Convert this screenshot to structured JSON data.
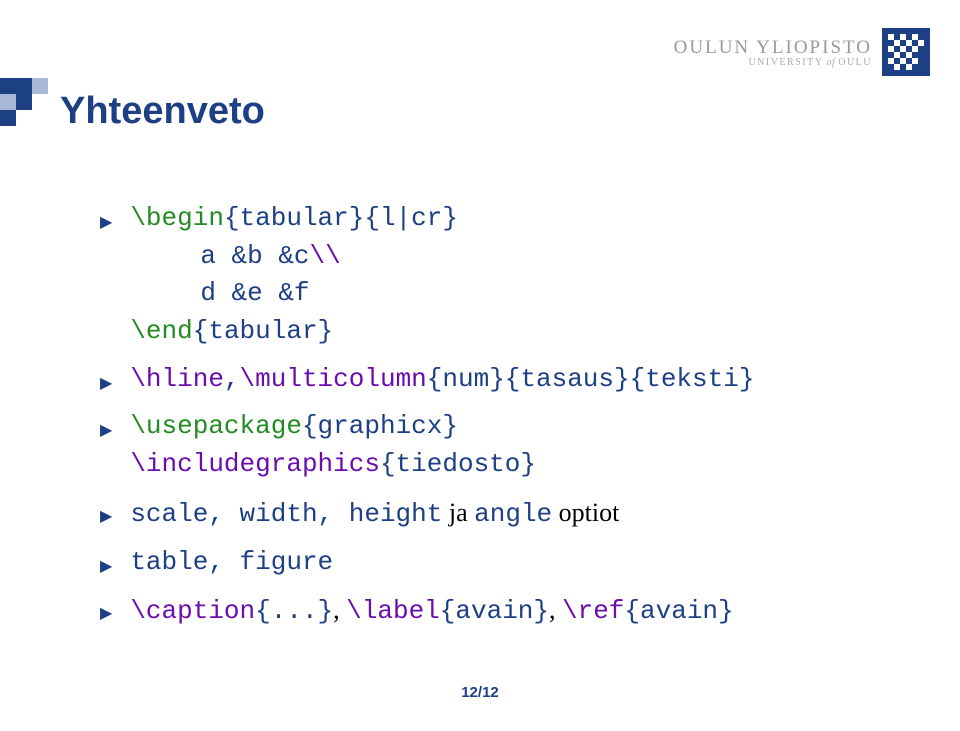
{
  "header": {
    "logo_main": "OULUN YLIOPISTO",
    "logo_sub_university": "UNIVERSITY",
    "logo_sub_of": " of ",
    "logo_sub_oulu": "OULU"
  },
  "title": "Yhteenveto",
  "items": [
    {
      "lines": [
        {
          "segments": [
            {
              "text": "\\begin",
              "cls": "c-green"
            },
            {
              "text": "{tabular}{l|cr}",
              "cls": "c-navy"
            }
          ]
        },
        {
          "sub": true,
          "segments": [
            {
              "text": "a &b &c",
              "cls": "c-navy"
            },
            {
              "text": "\\\\",
              "cls": "c-purple"
            }
          ]
        },
        {
          "sub": true,
          "segments": [
            {
              "text": "d &e &f",
              "cls": "c-navy"
            }
          ]
        },
        {
          "segments": [
            {
              "text": "\\end",
              "cls": "c-green"
            },
            {
              "text": "{tabular}",
              "cls": "c-navy"
            }
          ]
        }
      ]
    },
    {
      "lines": [
        {
          "segments": [
            {
              "text": "\\hline",
              "cls": "c-purple"
            },
            {
              "text": ",",
              "cls": "c-navy"
            },
            {
              "text": "\\multicolumn",
              "cls": "c-purple"
            },
            {
              "text": "{num}{tasaus}{teksti}",
              "cls": "c-navy"
            }
          ]
        }
      ]
    },
    {
      "lines": [
        {
          "segments": [
            {
              "text": "\\usepackage",
              "cls": "c-green"
            },
            {
              "text": "{graphicx}",
              "cls": "c-navy"
            }
          ]
        },
        {
          "segments": [
            {
              "text": "\\includegraphics",
              "cls": "c-purple"
            },
            {
              "text": "{tiedosto}",
              "cls": "c-navy"
            }
          ]
        }
      ]
    },
    {
      "lines": [
        {
          "segments": [
            {
              "text": "scale, width, height",
              "cls": "c-navy",
              "mono": true
            },
            {
              "text": " ja ",
              "cls": "plain"
            },
            {
              "text": "angle",
              "cls": "c-navy",
              "mono": true
            },
            {
              "text": " optiot",
              "cls": "plain"
            }
          ]
        }
      ]
    },
    {
      "lines": [
        {
          "segments": [
            {
              "text": "table, figure",
              "cls": "c-navy",
              "mono": true
            }
          ]
        }
      ]
    },
    {
      "lines": [
        {
          "segments": [
            {
              "text": "\\caption",
              "cls": "c-purple"
            },
            {
              "text": "{...}",
              "cls": "c-navy"
            },
            {
              "text": ", ",
              "cls": "plain"
            },
            {
              "text": "\\label",
              "cls": "c-purple"
            },
            {
              "text": "{avain}",
              "cls": "c-navy"
            },
            {
              "text": ", ",
              "cls": "plain"
            },
            {
              "text": "\\ref",
              "cls": "c-purple"
            },
            {
              "text": "{avain}",
              "cls": "c-navy"
            }
          ]
        }
      ]
    }
  ],
  "page_number": "12/12"
}
